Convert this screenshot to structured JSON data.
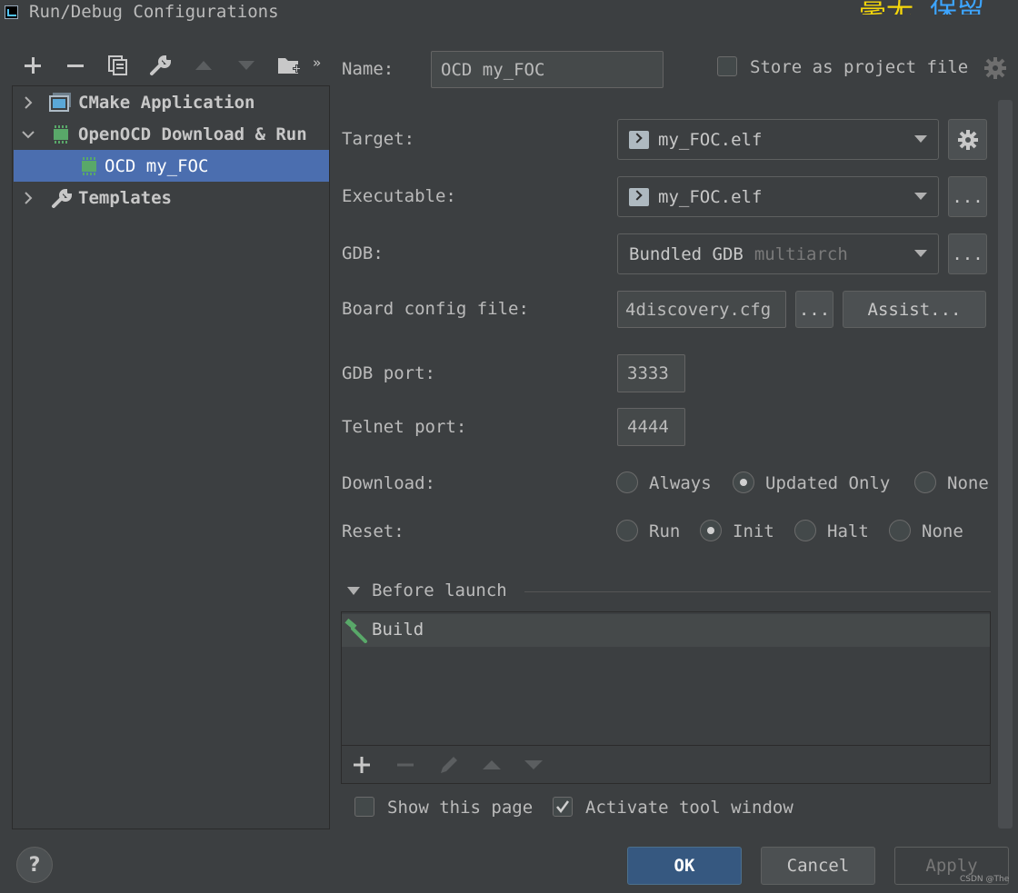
{
  "window": {
    "title": "Run/Debug Configurations"
  },
  "tree": {
    "items": [
      {
        "label": "CMake Application"
      },
      {
        "label": "OpenOCD Download & Run"
      },
      {
        "label": "OCD my_FOC"
      },
      {
        "label": "Templates"
      }
    ]
  },
  "form": {
    "name_label": "Name:",
    "name_value": "OCD my_FOC",
    "store_label": "Store as project file",
    "target_label": "Target:",
    "target_value": "my_FOC.elf",
    "executable_label": "Executable:",
    "executable_value": "my_FOC.elf",
    "gdb_label": "GDB:",
    "gdb_value": "Bundled GDB",
    "gdb_hint": "multiarch",
    "board_label": "Board config file:",
    "board_value": "4discovery.cfg",
    "browse_label": "...",
    "assist_label": "Assist...",
    "gdb_port_label": "GDB port:",
    "gdb_port_value": "3333",
    "telnet_port_label": "Telnet port:",
    "telnet_port_value": "4444",
    "download_label": "Download:",
    "download_options": [
      "Always",
      "Updated Only",
      "None"
    ],
    "download_selected": "Updated Only",
    "reset_label": "Reset:",
    "reset_options": [
      "Run",
      "Init",
      "Halt",
      "None"
    ],
    "reset_selected": "Init"
  },
  "before_launch": {
    "title": "Before launch",
    "items": [
      "Build"
    ]
  },
  "footer": {
    "show_page_label": "Show this page",
    "show_page_checked": false,
    "activate_label": "Activate tool window",
    "activate_checked": true,
    "help": "?",
    "ok": "OK",
    "cancel": "Cancel",
    "apply": "Apply"
  },
  "watermark": "CSDN @The",
  "corner_art": {
    "yellow_text": "毫无",
    "blue_text": "保留"
  }
}
